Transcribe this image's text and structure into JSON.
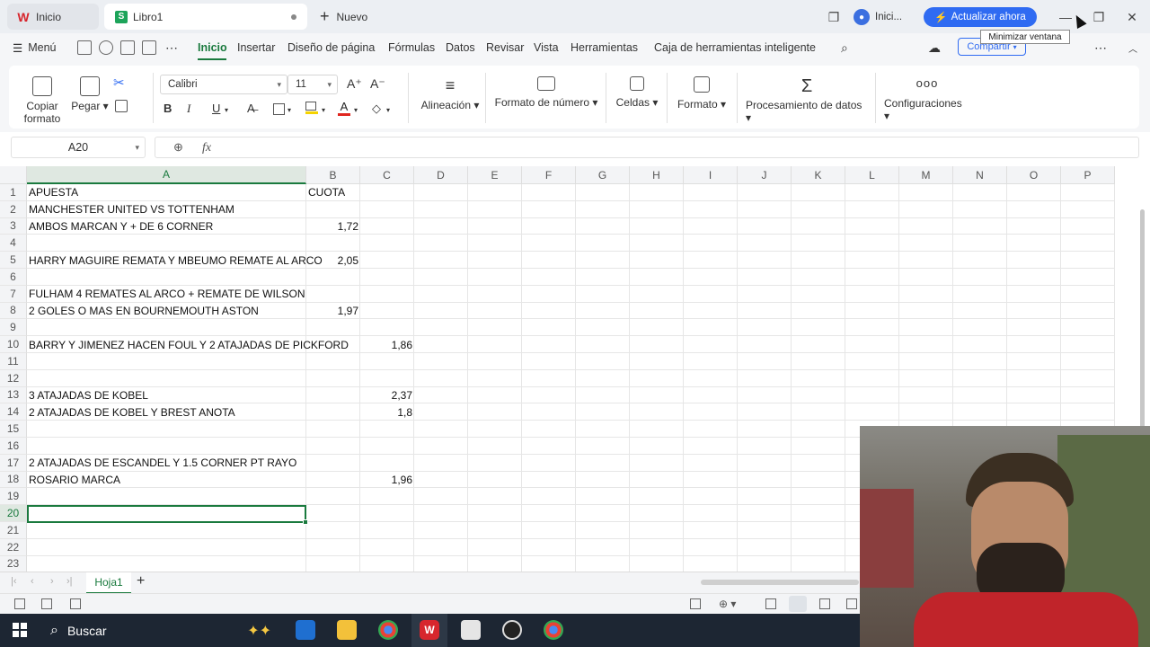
{
  "tabs": {
    "home": "Inicio",
    "file": "Libro1",
    "new": "Nuevo"
  },
  "top": {
    "login": "Inici...",
    "upgrade": "Actualizar ahora",
    "tooltip": "Minimizar ventana"
  },
  "menu": {
    "main": "Menú",
    "items": [
      "Inicio",
      "Insertar",
      "Diseño de página",
      "Fórmulas",
      "Datos",
      "Revisar",
      "Vista",
      "Herramientas",
      "Caja de herramientas inteligente"
    ],
    "share": "Compartir"
  },
  "ribbon": {
    "copy_format": "Copiar formato",
    "paste": "Pegar",
    "font": "Calibri",
    "size": "11",
    "bold": "B",
    "italic": "I",
    "underline": "U",
    "align": "Alineación",
    "number_format": "Formato de número",
    "cells": "Celdas",
    "format": "Formato",
    "data_proc": "Procesamiento de datos",
    "settings": "Configuraciones"
  },
  "formula": {
    "namebox": "A20",
    "fx": "fx",
    "value": ""
  },
  "grid": {
    "columns": [
      "A",
      "B",
      "C",
      "D",
      "E",
      "F",
      "G",
      "H",
      "I",
      "J",
      "K",
      "L",
      "M",
      "N",
      "O",
      "P"
    ],
    "rows": [
      "1",
      "2",
      "3",
      "4",
      "5",
      "6",
      "7",
      "8",
      "9",
      "10",
      "11",
      "12",
      "13",
      "14",
      "15",
      "16",
      "17",
      "18",
      "19",
      "20",
      "21",
      "22",
      "23"
    ],
    "cells": [
      {
        "row": 1,
        "col": "A",
        "v": "APUESTA"
      },
      {
        "row": 1,
        "col": "B",
        "v": "CUOTA"
      },
      {
        "row": 2,
        "col": "A",
        "v": "MANCHESTER UNITED VS TOTTENHAM"
      },
      {
        "row": 3,
        "col": "A",
        "v": "AMBOS MARCAN Y + DE 6 CORNER"
      },
      {
        "row": 3,
        "col": "B",
        "v": "1,72",
        "num": true
      },
      {
        "row": 5,
        "col": "A",
        "v": "HARRY MAGUIRE REMATA Y MBEUMO REMATE AL ARCO"
      },
      {
        "row": 5,
        "col": "B",
        "v": "2,05",
        "num": true
      },
      {
        "row": 7,
        "col": "A",
        "v": "FULHAM 4 REMATES AL ARCO + REMATE DE WILSON"
      },
      {
        "row": 8,
        "col": "A",
        "v": "2 GOLES O MAS EN BOURNEMOUTH ASTON"
      },
      {
        "row": 8,
        "col": "B",
        "v": "1,97",
        "num": true
      },
      {
        "row": 10,
        "col": "A",
        "v": "BARRY Y JIMENEZ HACEN FOUL Y 2 ATAJADAS DE PICKFORD"
      },
      {
        "row": 10,
        "col": "C",
        "v": "1,86",
        "num": true
      },
      {
        "row": 13,
        "col": "A",
        "v": "3 ATAJADAS DE KOBEL"
      },
      {
        "row": 13,
        "col": "C",
        "v": "2,37",
        "num": true
      },
      {
        "row": 14,
        "col": "A",
        "v": "2 ATAJADAS DE KOBEL Y BREST ANOTA"
      },
      {
        "row": 14,
        "col": "C",
        "v": "1,8",
        "num": true
      },
      {
        "row": 17,
        "col": "A",
        "v": "2 ATAJADAS DE ESCANDEL Y 1.5 CORNER PT RAYO"
      },
      {
        "row": 18,
        "col": "A",
        "v": "ROSARIO MARCA"
      },
      {
        "row": 18,
        "col": "C",
        "v": "1,96",
        "num": true
      }
    ]
  },
  "sheet": {
    "tab": "Hoja1",
    "add": "+"
  },
  "taskbar": {
    "search": "Buscar"
  }
}
